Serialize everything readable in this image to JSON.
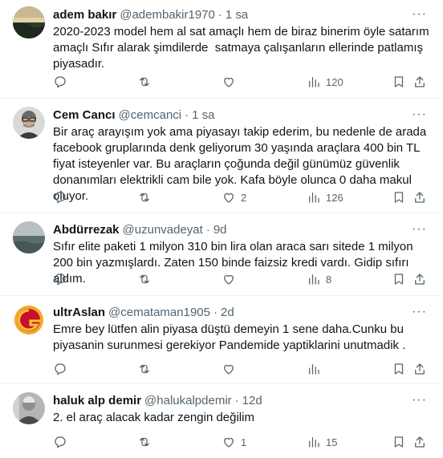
{
  "tweets": [
    {
      "name": "adem bakır",
      "handle": "@adembakir1970",
      "time": "1 sa",
      "text": "2020-2023 model hem al sat amaçlı hem de biraz binerim öyle satarım amaçlı Sıfır alarak şimdilerde  satmaya çalışanların ellerinde patlamış piyasadır.",
      "likes": "",
      "views": "120",
      "avatar": "landscape"
    },
    {
      "name": "Cem Cancı",
      "handle": "@cemcanci",
      "time": "1 sa",
      "text": "Bir araç arayışım yok ama piyasayı takip ederim, bu nedenle de arada facebook gruplarında denk geliyorum 30 yaşında araçlara 400 bin TL fiyat isteyenler var. Bu araçların çoğunda değil günümüz güvenlik donanımları elektrikli cam bile yok. Kafa böyle olunca 0 daha makul oluyor.",
      "likes": "2",
      "views": "126",
      "avatar": "person-glasses"
    },
    {
      "name": "Abdürrezak",
      "handle": "@uzunvadeyat",
      "time": "9d",
      "text": "Sıfır elite paketi 1 milyon 310 bin lira olan araca sarı sitede 1 milyon 200 bin yazmışlardı. Zaten 150 binde faizsiz kredi vardı. Gidip sıfırı aldım.",
      "likes": "",
      "views": "8",
      "avatar": "sea"
    },
    {
      "name": "ultrAslan",
      "handle": "@cemataman1905",
      "time": "2d",
      "text": "Emre bey lütfen alin piyasa düştü demeyin 1 sene daha.Cunku bu piyasanin surunmesi gerekiyor Pandemide yaptiklarini unutmadik .",
      "likes": "",
      "views": "",
      "avatar": "galatasaray-logo"
    },
    {
      "name": "haluk alp demir",
      "handle": "@halukalpdemir",
      "time": "12d",
      "text": "2. el araç alacak kadar zengin değilim",
      "likes": "1",
      "views": "15",
      "avatar": "person-bw"
    }
  ],
  "separator": "·",
  "more": "···"
}
